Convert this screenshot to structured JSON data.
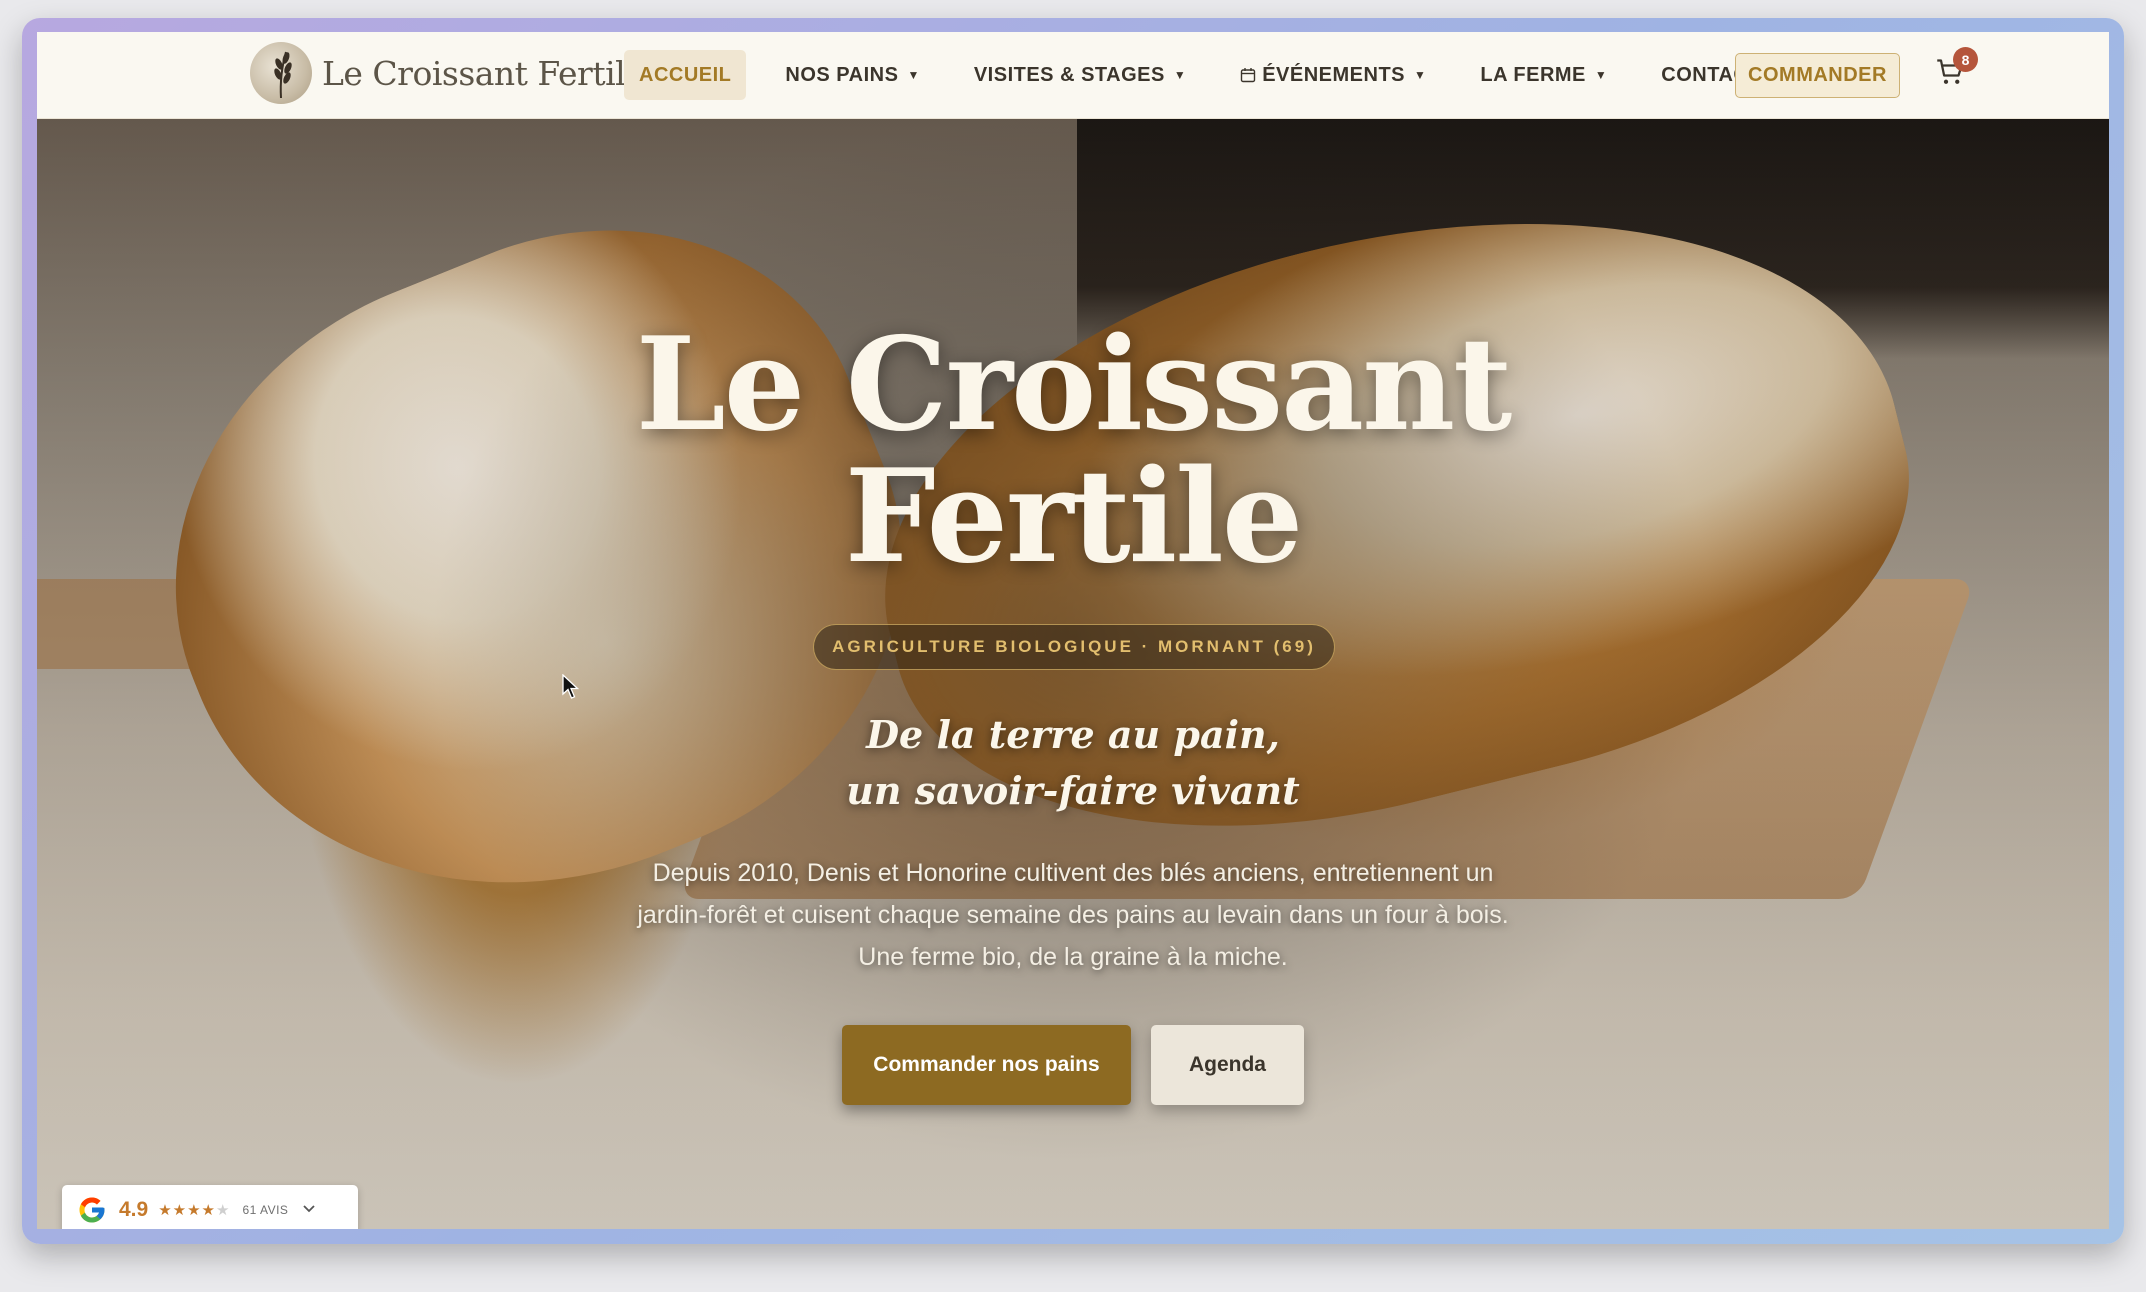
{
  "site": {
    "logo_text": "Le Croissant Fertile"
  },
  "nav": {
    "items": [
      {
        "label": "ACCUEIL",
        "active": true
      },
      {
        "label": "NOS PAINS",
        "dropdown": true
      },
      {
        "label": "VISITES & STAGES",
        "dropdown": true
      },
      {
        "label": "ÉVÉNEMENTS",
        "dropdown": true,
        "icon": "calendar-icon"
      },
      {
        "label": "LA FERME",
        "dropdown": true
      },
      {
        "label": "CONTACT"
      }
    ],
    "order_label": "COMMANDER",
    "cart_count": "8"
  },
  "hero": {
    "title_line1": "Le Croissant",
    "title_line2": "Fertile",
    "tag": "AGRICULTURE BIOLOGIQUE · MORNANT (69)",
    "subtitle_line1": "De la terre au pain,",
    "subtitle_line2": "un savoir-faire vivant",
    "lead_line1": "Depuis 2010, Denis et Honorine cultivent des blés anciens, entretiennent un",
    "lead_line2": "jardin-forêt et cuisent chaque semaine des pains au levain dans un four à bois.",
    "lead_line3": "Une ferme bio, de la graine à la miche.",
    "primary_button": "Commander nos pains",
    "secondary_button": "Agenda"
  },
  "review_widget": {
    "rating": "4.9",
    "stars_filled": 4,
    "stars_total": 5,
    "count_label": "61 AVIS"
  },
  "colors": {
    "accent": "#a37a26",
    "primary_button": "#8d6a22",
    "nav_bg": "#faf8f1",
    "badge": "#b5553b"
  }
}
